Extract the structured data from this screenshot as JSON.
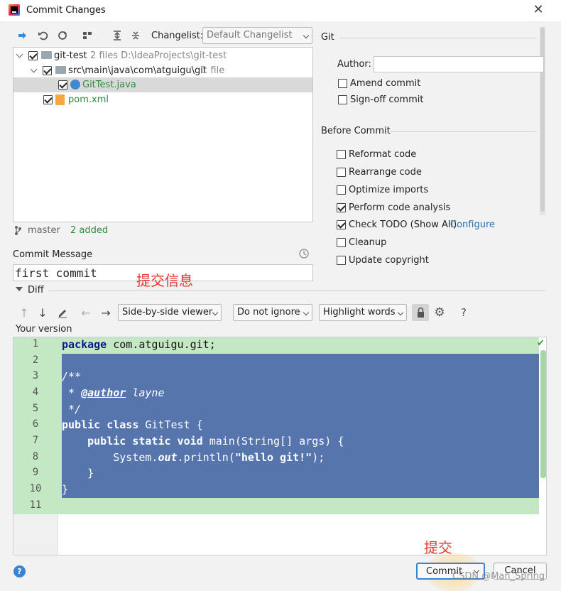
{
  "window": {
    "title": "Commit Changes"
  },
  "toolbar": {
    "changelist_label": "Changelist:",
    "changelist_value": "Default Changelist"
  },
  "tree": {
    "root": {
      "name": "git-test",
      "meta": "2 files  D:\\IdeaProjects\\git-test"
    },
    "folder": {
      "name": "src\\main\\java\\com\\atguigu\\git",
      "meta": "1 file"
    },
    "file1": {
      "name": "GitTest.java"
    },
    "file2": {
      "name": "pom.xml"
    }
  },
  "status": {
    "branch": "master",
    "added": "2 added"
  },
  "commit_message": {
    "label": "Commit Message",
    "value": "first commit",
    "annotation": "提交信息"
  },
  "git_panel": {
    "title": "Git",
    "author_label": "Author:",
    "amend": "Amend commit",
    "signoff": "Sign-off commit"
  },
  "before_commit": {
    "title": "Before Commit",
    "items": [
      {
        "label": "Reformat code",
        "checked": false
      },
      {
        "label": "Rearrange code",
        "checked": false
      },
      {
        "label": "Optimize imports",
        "checked": false
      },
      {
        "label": "Perform code analysis",
        "checked": true
      },
      {
        "label": "Check TODO (Show All)",
        "checked": true,
        "link": "Configure"
      },
      {
        "label": "Cleanup",
        "checked": false
      },
      {
        "label": "Update copyright",
        "checked": false
      }
    ]
  },
  "diff": {
    "title": "Diff",
    "viewer": "Side-by-side viewer",
    "ignore": "Do not ignore",
    "highlight": "Highlight words",
    "version_label": "Your version",
    "line_numbers": [
      "1",
      "2",
      "3",
      "4",
      "5",
      "6",
      "7",
      "8",
      "9",
      "10",
      "11"
    ]
  },
  "buttons": {
    "commit": "Commit",
    "cancel": "Cancel",
    "commit_annotation": "提交"
  },
  "watermark": "CSDN @Man_Spring",
  "colors": {
    "added_green": "#c4e8c4",
    "selection_blue": "#5675ad",
    "link_blue": "#2470b3",
    "annotation_red": "#e53935"
  }
}
